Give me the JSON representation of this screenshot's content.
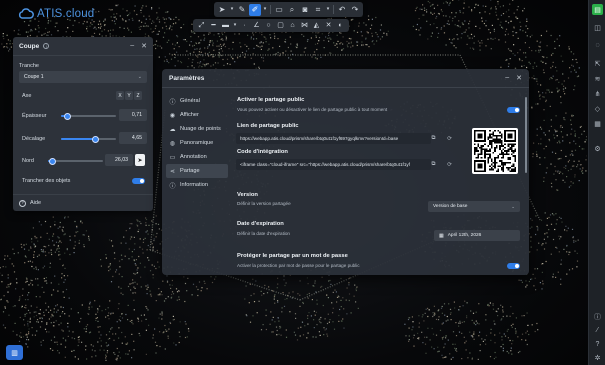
{
  "app": {
    "logo_text": "ATIS.cloud",
    "brand_color": "#4d93e0",
    "accent_color": "#2f7de8"
  },
  "toolbar_top": [
    {
      "icon": "cursor-icon",
      "active": false
    },
    {
      "icon": "chevron-down-icon",
      "active": false
    },
    {
      "icon": "pencil-icon",
      "active": false
    },
    {
      "icon": "brush-icon",
      "active": true
    },
    {
      "icon": "chevron-down-icon",
      "active": false
    },
    {
      "icon": "comment-icon",
      "active": false
    },
    {
      "icon": "search-icon",
      "active": false
    },
    {
      "icon": "camera-icon",
      "active": false
    },
    {
      "icon": "crop-icon",
      "active": false
    },
    {
      "icon": "chevron-down-icon",
      "active": false
    },
    {
      "icon": "undo-icon",
      "active": false
    },
    {
      "icon": "redo-icon",
      "active": false
    }
  ],
  "toolbar_measure": [
    {
      "icon": "measure-distance-icon"
    },
    {
      "icon": "measure-line-icon"
    },
    {
      "icon": "measure-segment-icon"
    },
    {
      "icon": "chevron-down-icon"
    },
    {
      "icon": "ruler-icon"
    },
    {
      "icon": "angle-icon"
    },
    {
      "icon": "circle-icon"
    },
    {
      "icon": "area-icon"
    },
    {
      "icon": "volume-icon"
    },
    {
      "icon": "profile-icon"
    },
    {
      "icon": "height-icon"
    },
    {
      "icon": "delete-measure-icon"
    },
    {
      "icon": "visibility-icon"
    }
  ],
  "coupe": {
    "title": "Coupe",
    "tranche_label": "Tranche",
    "tranche_value": "Coupe 1",
    "axe_label": "Axe",
    "axes": [
      "X",
      "Y",
      "Z"
    ],
    "epaisseur_label": "Épaisseur",
    "epaisseur_value": "0,71",
    "epaisseur_level": 0.12,
    "decalage_label": "Décalage",
    "decalage_value": "4,65",
    "decalage_level": 0.62,
    "nord_label": "Nord",
    "nord_value": "26,03",
    "nord_level": 0.08,
    "trancher_label": "Trancher des objets",
    "trancher_on": true,
    "help_label": "Aide"
  },
  "settings": {
    "title": "Paramètres",
    "nav": [
      {
        "label": "Général",
        "icon": "info-icon",
        "active": false
      },
      {
        "label": "Afficher",
        "icon": "eye-icon",
        "active": false
      },
      {
        "label": "Nuage de points",
        "icon": "cloud-icon",
        "active": false
      },
      {
        "label": "Panoramique",
        "icon": "panorama-icon",
        "active": false
      },
      {
        "label": "Annotation",
        "icon": "annotation-icon",
        "active": false
      },
      {
        "label": "Partage",
        "icon": "share-icon",
        "active": true
      },
      {
        "label": "Information",
        "icon": "info-icon",
        "active": false
      }
    ],
    "share_title": "Activer le partage public",
    "share_desc": "Vous pouvez activer ou désactiver le lien de partage public à tout moment",
    "share_on": true,
    "link_title": "Lien de partage public",
    "link_value": "https://webapp.atis.cloud/prism/share/btq0ut1f1yf697gyqlkmv?versionId=base",
    "embed_title": "Code d'intégration",
    "embed_value": "<iframe class=\"cloud-iframe\" src=\"https://webapp.atis.cloud/prism/share/btq0ut1f1yf",
    "version_title": "Version",
    "version_desc": "Définir la version partagée",
    "version_value": "Version de base",
    "expiry_title": "Date d'expiration",
    "expiry_desc": "Définir la date d'expiration",
    "expiry_value": "April 12th, 2026",
    "password_title": "Protéger le partage par un mot de passe",
    "password_desc": "Activer la protection par mot de passe pour le partage public",
    "password_on": true
  }
}
